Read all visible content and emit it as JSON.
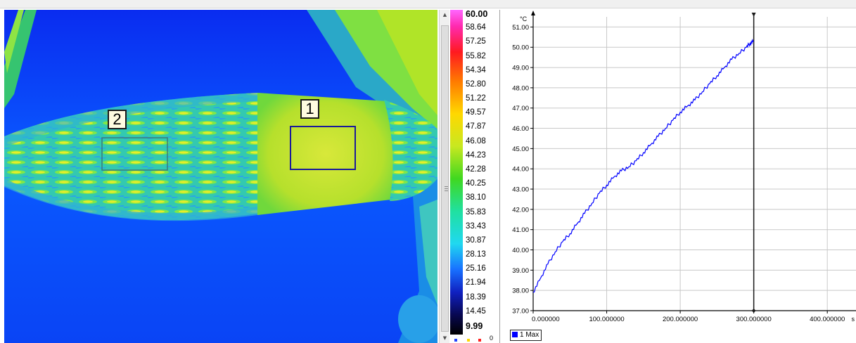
{
  "thermal_view": {
    "roi_1_label": "1",
    "roi_2_label": "2"
  },
  "color_scale": {
    "labels": [
      "60.00",
      "58.64",
      "57.25",
      "55.82",
      "54.34",
      "52.80",
      "51.22",
      "49.57",
      "47.87",
      "46.08",
      "44.23",
      "42.28",
      "40.25",
      "38.10",
      "35.83",
      "33.43",
      "30.87",
      "28.13",
      "25.16",
      "21.94",
      "18.39",
      "14.45",
      "9.99"
    ],
    "bold_labels": [
      "60.00",
      "9.99"
    ],
    "swatch_count_label": "0"
  },
  "chart_data": {
    "type": "line",
    "ylabel": "°C",
    "xlabel": "s",
    "xlim": [
      0,
      440
    ],
    "ylim": [
      37.0,
      51.5
    ],
    "x_ticks": [
      "0.000000",
      "100.000000",
      "200.000000",
      "300.000000",
      "400.000000"
    ],
    "x_tick_values": [
      0,
      100,
      200,
      300,
      400
    ],
    "y_ticks": [
      "37.00",
      "38.00",
      "39.00",
      "40.00",
      "41.00",
      "42.00",
      "43.00",
      "44.00",
      "45.00",
      "46.00",
      "47.00",
      "48.00",
      "49.00",
      "50.00",
      "51.00"
    ],
    "y_tick_values": [
      37,
      38,
      39,
      40,
      41,
      42,
      43,
      44,
      45,
      46,
      47,
      48,
      49,
      50,
      51
    ],
    "cursor_x": 300,
    "series": [
      {
        "name": "1 Max",
        "color": "#0000ff",
        "x": [
          0,
          10,
          20,
          30,
          40,
          50,
          60,
          70,
          80,
          90,
          100,
          110,
          120,
          130,
          140,
          150,
          160,
          170,
          180,
          190,
          200,
          210,
          220,
          230,
          240,
          250,
          260,
          270,
          280,
          290,
          295,
          300
        ],
        "values": [
          37.9,
          38.6,
          39.3,
          39.9,
          40.4,
          40.8,
          41.3,
          41.8,
          42.3,
          42.8,
          43.2,
          43.6,
          43.9,
          44.1,
          44.4,
          44.8,
          45.2,
          45.6,
          46.0,
          46.4,
          46.8,
          47.1,
          47.4,
          47.8,
          48.2,
          48.6,
          49.0,
          49.4,
          49.7,
          50.0,
          50.2,
          50.3
        ]
      }
    ]
  }
}
